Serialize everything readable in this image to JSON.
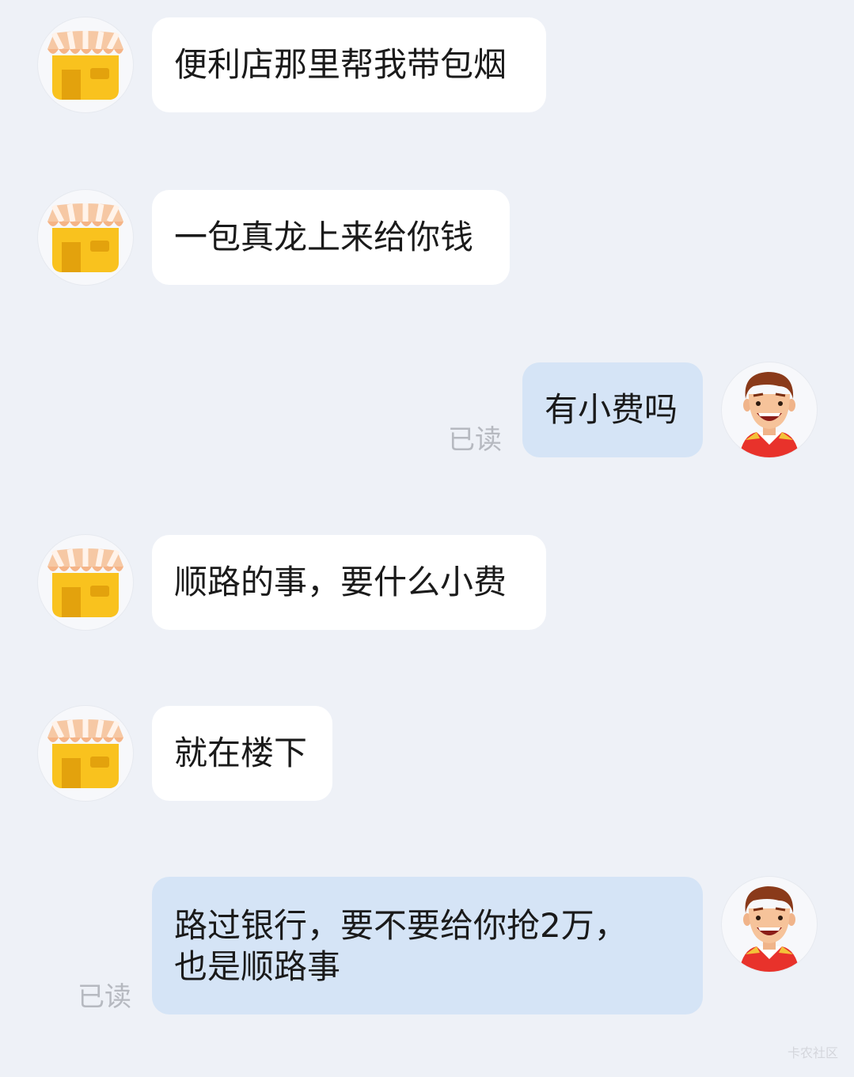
{
  "icons": {
    "shop": "shop-avatar-icon",
    "user": "user-avatar-icon"
  },
  "messages": [
    {
      "side": "in",
      "text": "便利店那里帮我带包烟"
    },
    {
      "side": "in",
      "text": "一包真龙上来给你钱"
    },
    {
      "side": "out",
      "text": "有小费吗",
      "read": "已读"
    },
    {
      "side": "in",
      "text": "顺路的事，要什么小费"
    },
    {
      "side": "in",
      "text": "就在楼下"
    },
    {
      "side": "out",
      "lines": [
        "路过银行，要不要给你抢2万，",
        "也是顺路事"
      ],
      "read": "已读"
    }
  ],
  "watermark": "卡农社区",
  "colors": {
    "background": "#eef1f7",
    "incoming_bubble": "#ffffff",
    "outgoing_bubble": "#d5e4f6",
    "read_text": "#b6b9c0"
  }
}
